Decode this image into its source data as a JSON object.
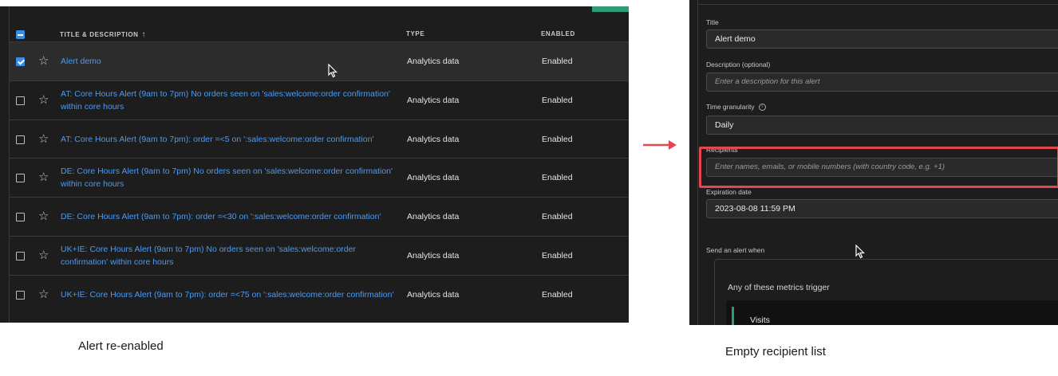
{
  "left": {
    "table": {
      "headers": {
        "title": "TITLE & DESCRIPTION",
        "type": "TYPE",
        "enabled": "ENABLED"
      },
      "sort_icon": "arrow-up-icon",
      "rows": [
        {
          "title": "Alert demo",
          "type": "Analytics data",
          "enabled": "Enabled",
          "checked": true
        },
        {
          "title": "AT: Core Hours Alert (9am to 7pm) No orders seen on 'sales:welcome:order confirmation' within core hours",
          "type": "Analytics data",
          "enabled": "Enabled",
          "checked": false
        },
        {
          "title": "AT: Core Hours Alert (9am to 7pm): order =<5 on ':sales:welcome:order confirmation'",
          "type": "Analytics data",
          "enabled": "Enabled",
          "checked": false
        },
        {
          "title": "DE: Core Hours Alert (9am to 7pm) No orders seen on 'sales:welcome:order confirmation' within core hours",
          "type": "Analytics data",
          "enabled": "Enabled",
          "checked": false
        },
        {
          "title": "DE: Core Hours Alert (9am to 7pm): order =<30 on ':sales:welcome:order confirmation'",
          "type": "Analytics data",
          "enabled": "Enabled",
          "checked": false
        },
        {
          "title": "UK+IE: Core Hours Alert (9am to 7pm) No orders seen on 'sales:welcome:order confirmation' within core hours",
          "type": "Analytics data",
          "enabled": "Enabled",
          "checked": false
        },
        {
          "title": "UK+IE: Core Hours Alert (9am to 7pm): order =<75 on ':sales:welcome:order confirmation'",
          "type": "Analytics data",
          "enabled": "Enabled",
          "checked": false
        }
      ]
    },
    "caption": "Alert re-enabled"
  },
  "right": {
    "form": {
      "title_label": "Title",
      "title_value": "Alert demo",
      "description_label": "Description (optional)",
      "description_placeholder": "Enter a description for this alert",
      "granularity_label": "Time granularity",
      "granularity_value": "Daily",
      "recipients_label": "Recipients",
      "recipients_placeholder": "Enter names, emails, or mobile numbers (with country code, e.g. +1)",
      "expiration_label": "Expiration date",
      "expiration_value": "2023-08-08 11:59 PM",
      "send_label": "Send an alert when",
      "trigger_title": "Any of these metrics trigger",
      "metric": "Visits"
    },
    "caption": "Empty recipient list"
  },
  "colors": {
    "link": "#4c9bf1",
    "accent": "#3a8de6",
    "highlight": "#e34850",
    "success": "#2d9d78"
  }
}
